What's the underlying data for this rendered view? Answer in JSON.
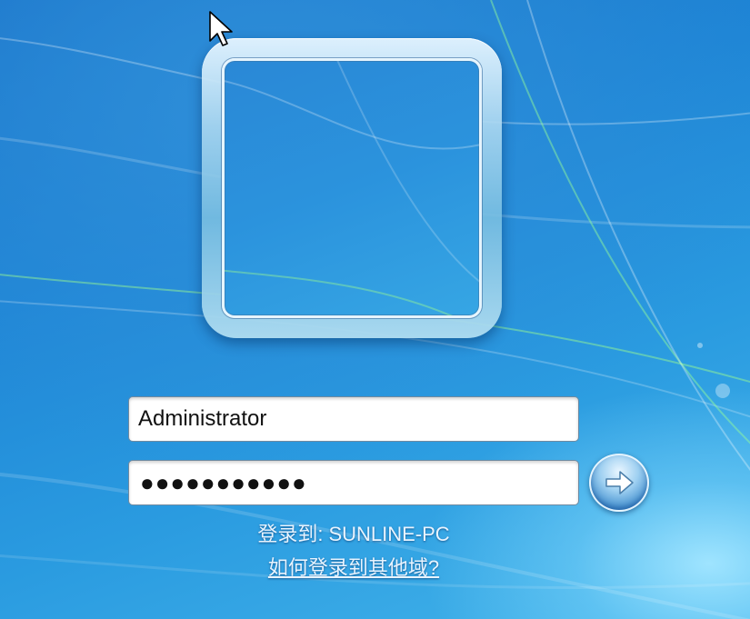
{
  "login": {
    "username_value": "Administrator",
    "password_masked": "●●●●●●●●●●●",
    "logon_to_label": "登录到:",
    "computer_name": "SUNLINE-PC",
    "other_domain_link": "如何登录到其他域?"
  },
  "icons": {
    "submit": "arrow-right-icon",
    "cursor": "mouse-pointer-icon"
  },
  "colors": {
    "background": "#1f86d6",
    "link_text": "#e8f4ff"
  }
}
